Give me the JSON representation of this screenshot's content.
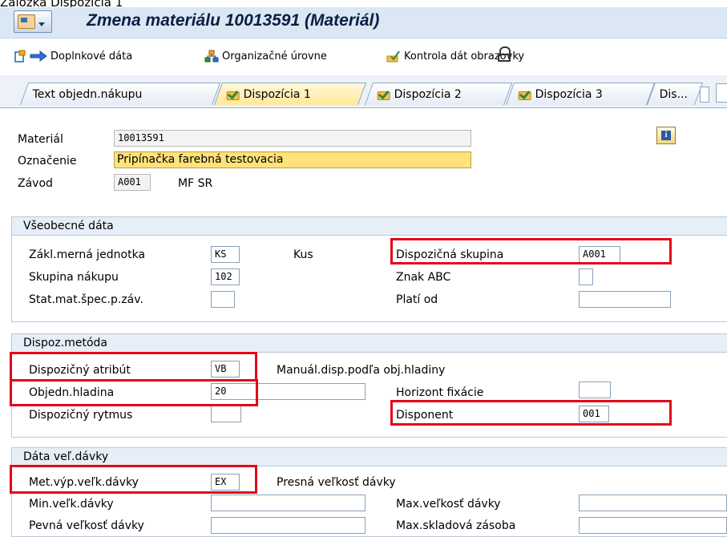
{
  "window_caption_cut": "Záložka Dispozícia 1",
  "title": "Zmena materiálu 10013591 (Materiál)",
  "toolbar": {
    "extra_data": "Doplnkové dáta",
    "org_levels": "Organizačné úrovne",
    "check_screen": "Kontrola dát obrazovky"
  },
  "tabs": [
    {
      "label": "Text objedn.nákupu",
      "active": false,
      "icon": ""
    },
    {
      "label": "Dispozícia 1",
      "active": true,
      "icon": "checked-icon"
    },
    {
      "label": "Dispozícia 2",
      "active": false,
      "icon": "checked-icon"
    },
    {
      "label": "Dispozícia 3",
      "active": false,
      "icon": "checked-icon"
    },
    {
      "label": "Dis...",
      "active": false,
      "icon": ""
    }
  ],
  "header": {
    "material_label": "Materiál",
    "material_value": "10013591",
    "description_label": "Označenie",
    "description_value": "Pripínačka farebná testovacia",
    "plant_label": "Závod",
    "plant_value": "A001",
    "plant_name": "MF SR",
    "info_button": "i"
  },
  "general": {
    "title": "Všeobecné dáta",
    "base_uom_label": "Zákl.merná jednotka",
    "base_uom_value": "KS",
    "base_uom_text": "Kus",
    "mrp_group_label": "Dispozičná skupina",
    "mrp_group_value": "A001",
    "purch_group_label": "Skupina nákupu",
    "purch_group_value": "102",
    "abc_label": "Znak ABC",
    "abc_value": "",
    "plant_status_label": "Stat.mat.špec.p.záv.",
    "plant_status_value": "",
    "valid_from_label": "Platí od",
    "valid_from_value": ""
  },
  "mrp_procedure": {
    "title": "Dispoz.metóda",
    "mrp_type_label": "Dispozičný atribút",
    "mrp_type_value": "VB",
    "mrp_type_text": "Manuál.disp.podľa obj.hladiny",
    "reorder_label": "Objedn.hladina",
    "reorder_value": "20",
    "fixing_horizon_label": "Horizont fixácie",
    "fixing_horizon_value": "",
    "planning_cycle_label": "Dispozičný rytmus",
    "planning_cycle_value": "",
    "controller_label": "Disponent",
    "controller_value": "001"
  },
  "lot_size": {
    "title": "Dáta veľ.dávky",
    "lot_proc_label": "Met.výp.veľk.dávky",
    "lot_proc_value": "EX",
    "lot_proc_text": "Presná veľkosť dávky",
    "min_lot_label": "Min.veľk.dávky",
    "min_lot_value": "",
    "max_lot_label": "Max.veľkosť dávky",
    "max_lot_value": "",
    "fixed_lot_label": "Pevná veľkosť dávky",
    "fixed_lot_value": "",
    "max_stock_label": "Max.skladová zásoba",
    "max_stock_value": ""
  },
  "colors": {
    "highlight_box": "#e3061a",
    "focused_field": "#ffe27a",
    "title_text": "#0a1f44"
  }
}
